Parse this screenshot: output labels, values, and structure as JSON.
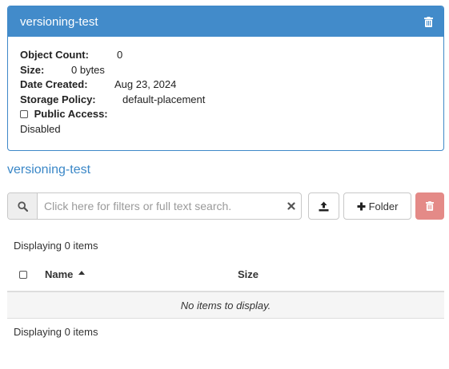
{
  "panel": {
    "title": "versioning-test",
    "fields": {
      "object_count_label": "Object Count:",
      "object_count_value": "0",
      "size_label": "Size:",
      "size_value": "0 bytes",
      "date_created_label": "Date Created:",
      "date_created_value": "Aug 23, 2024",
      "storage_policy_label": "Storage Policy:",
      "storage_policy_value": "default-placement",
      "public_access_label": "Public Access:",
      "public_access_value": "Disabled"
    }
  },
  "bucket_link": "versioning-test",
  "search": {
    "placeholder": "Click here for filters or full text search."
  },
  "toolbar": {
    "folder_label": "Folder"
  },
  "table": {
    "count_top": "Displaying 0 items",
    "col_name": "Name",
    "col_size": "Size",
    "empty_text": "No items to display.",
    "count_bottom": "Displaying 0 items"
  },
  "colors": {
    "primary": "#428bca",
    "danger": "#e48a87"
  },
  "icons": {
    "panel_delete": "trash-icon",
    "search": "search-icon",
    "clear": "clear-icon",
    "upload": "upload-icon",
    "folder_add": "plus-icon",
    "toolbar_delete": "trash-icon"
  }
}
